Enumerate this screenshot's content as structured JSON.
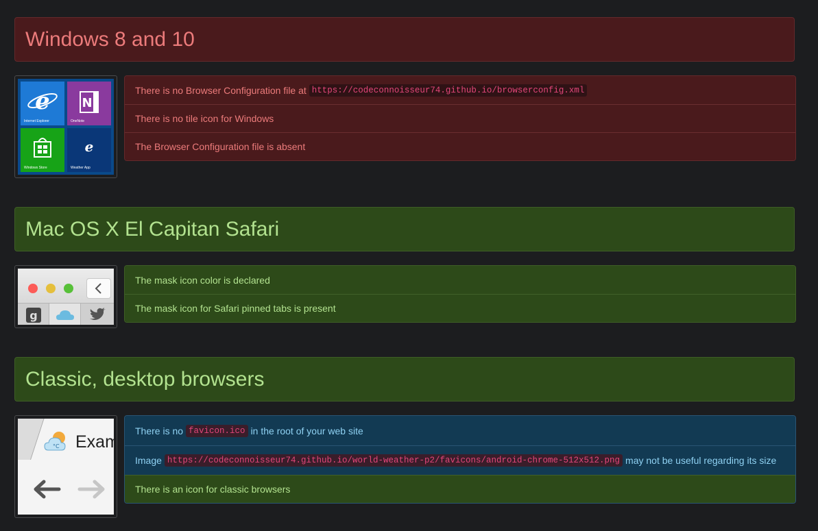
{
  "sections": [
    {
      "title": "Windows 8 and 10",
      "tiles": [
        {
          "label": "Internet Explorer",
          "color": "#1e7ad6"
        },
        {
          "label": "OneNote",
          "color": "#8a3a9e"
        },
        {
          "label": "Windows Store",
          "color": "#17a317"
        },
        {
          "label": "Weather App",
          "color": "#0a3778"
        }
      ],
      "items": [
        {
          "text_before": "There is no Browser Configuration file at",
          "code": "https://codeconnoisseur74.github.io/browserconfig.xml",
          "text_after": ""
        },
        {
          "text_before": "There is no tile icon for Windows"
        },
        {
          "text_before": "The Browser Configuration file is absent"
        }
      ]
    },
    {
      "title": "Mac OS X El Capitan Safari",
      "items": [
        {
          "text_before": "The mask icon color is declared"
        },
        {
          "text_before": "The mask icon for Safari pinned tabs is present"
        }
      ]
    },
    {
      "title": "Classic, desktop browsers",
      "tab_text": "Exam",
      "items": [
        {
          "text_before": "There is no",
          "code": "favicon.ico",
          "text_after": "in the root of your web site"
        },
        {
          "text_before": "Image",
          "code": "https://codeconnoisseur74.github.io/world-weather-p2/favicons/android-chrome-512x512.png",
          "text_after": "may not be useful regarding its size"
        },
        {
          "text_before": "There is an icon for classic browsers"
        }
      ]
    }
  ],
  "colors": {
    "error_bg": "#4a1a1c",
    "success_bg": "#2d4a19",
    "info_bg": "#123a53"
  }
}
